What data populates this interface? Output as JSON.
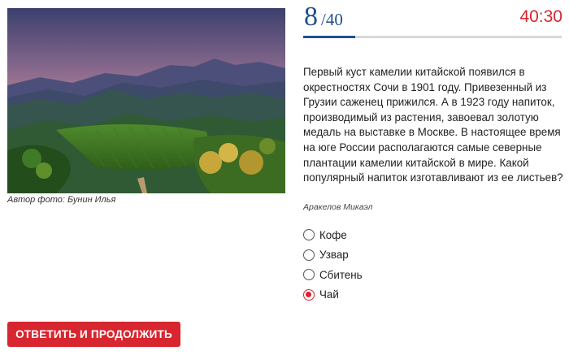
{
  "photo": {
    "alt_icon": "landscape-photo",
    "caption": "Автор фото: Бунин Илья"
  },
  "counter": {
    "current": "8",
    "total": "/40"
  },
  "progress": {
    "fraction": 0.2
  },
  "timer": "40:30",
  "question": {
    "text": "Первый куст камелии китайской появился в окрестностях Сочи в 1901 году. Привезенный из Грузии саженец прижился. А в 1923 году напиток, производимый из растения, завоевал золотую медаль на выставке в Москве. В настоящее время на юге России располагаются самые северные плантации камелии китайской в мире. Какой популярный напиток изготавливают из ее листьев?",
    "author": "Аракелов Микаэл"
  },
  "options": [
    {
      "label": "Кофе",
      "selected": false
    },
    {
      "label": "Узвар",
      "selected": false
    },
    {
      "label": "Сбитень",
      "selected": false
    },
    {
      "label": "Чай",
      "selected": true
    }
  ],
  "submit_label": "ОТВЕТИТЬ И ПРОДОЛЖИТЬ",
  "colors": {
    "accent": "#d7262f",
    "brand": "#1f4f8f"
  }
}
